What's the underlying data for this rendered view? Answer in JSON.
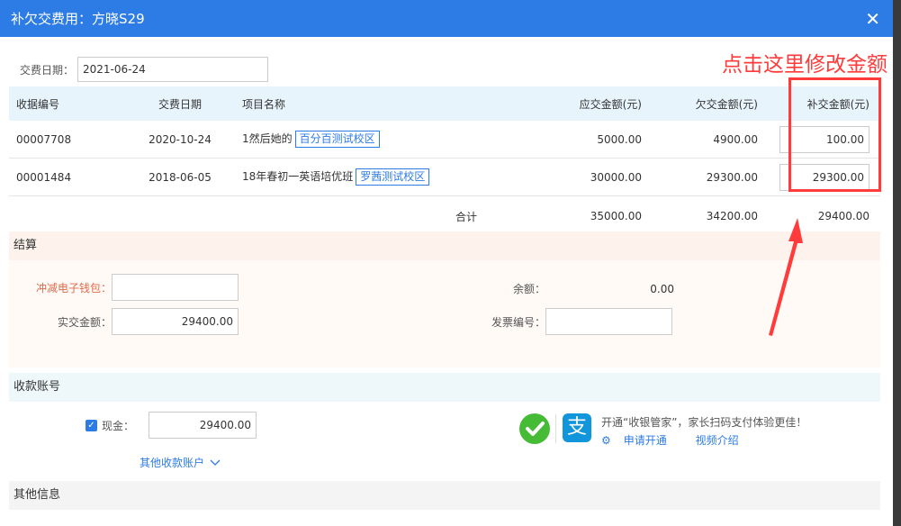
{
  "dialog": {
    "title": "补欠交费用：方晓S29",
    "close_glyph": "✕"
  },
  "pay_date": {
    "label": "交费日期：",
    "value": "2021-06-24"
  },
  "fees_table": {
    "headers": [
      "收据编号",
      "交费日期",
      "项目名称",
      "应交金额(元)",
      "欠交金额(元)",
      "补交金额(元)"
    ],
    "rows": [
      {
        "receipt": "00007708",
        "date": "2020-10-24",
        "item": "1然后她的",
        "campus": "百分百测试校区",
        "due": "5000.00",
        "owed": "4900.00",
        "repay": "100.00"
      },
      {
        "receipt": "00001484",
        "date": "2018-06-05",
        "item": "18年春初一英语培优班",
        "campus": "罗茜测试校区",
        "due": "30000.00",
        "owed": "29300.00",
        "repay": "29300.00"
      }
    ],
    "total": {
      "label": "合计",
      "due": "35000.00",
      "owed": "34200.00",
      "repay": "29400.00"
    }
  },
  "settlement": {
    "title": "结算",
    "wallet_label": "冲减电子钱包：",
    "wallet_value": "",
    "paid_label": "实交金额：",
    "paid_value": "29400.00",
    "balance_label": "余额：",
    "balance_value": "0.00",
    "invoice_label": "发票编号：",
    "invoice_value": ""
  },
  "account": {
    "title": "收款账号",
    "cash_label": "现金：",
    "cash_value": "29400.00",
    "other_accounts": "其他收款账户",
    "promo_text": "开通“收银管家”，家长扫码支付体验更佳！",
    "apply_link": "申请开通",
    "video_link": "视频介绍",
    "alipay_glyph": "支"
  },
  "other_info": {
    "title": "其他信息"
  },
  "annotation": {
    "text": "点击这里修改金额",
    "color": "#ff3b3b"
  },
  "colors": {
    "primary": "#2d7be5",
    "wechat": "#46bb36",
    "alipay": "#1296db",
    "annotation": "#ff3b3b"
  }
}
